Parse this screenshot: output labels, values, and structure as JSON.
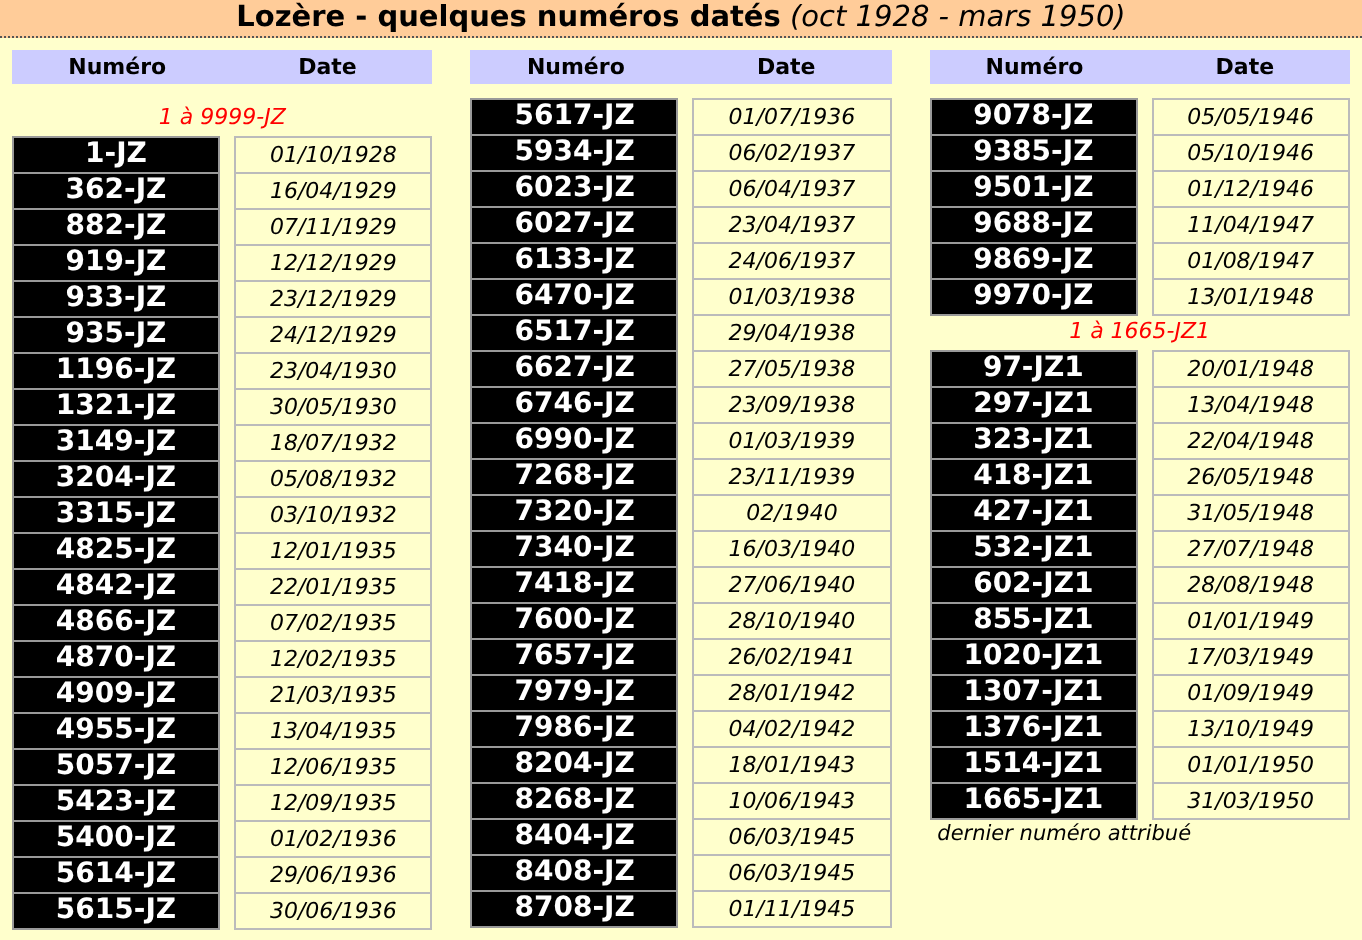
{
  "title": "**Lozère - quelques numéros datés** *(oct 1928 - mars 1950)*",
  "columns": [
    {
      "headers": [
        "Numéro",
        "Date"
      ],
      "groups": [
        {
          "label": "1 à 9999-JZ",
          "rows": [
            [
              "1-JZ",
              "01/10/1928"
            ],
            [
              "362-JZ",
              "16/04/1929"
            ],
            [
              "882-JZ",
              "07/11/1929"
            ],
            [
              "919-JZ",
              "12/12/1929"
            ],
            [
              "933-JZ",
              "23/12/1929"
            ],
            [
              "935-JZ",
              "24/12/1929"
            ],
            [
              "1196-JZ",
              "23/04/1930"
            ],
            [
              "1321-JZ",
              "30/05/1930"
            ],
            [
              "3149-JZ",
              "18/07/1932"
            ],
            [
              "3204-JZ",
              "05/08/1932"
            ],
            [
              "3315-JZ",
              "03/10/1932"
            ],
            [
              "4825-JZ",
              "12/01/1935"
            ],
            [
              "4842-JZ",
              "22/01/1935"
            ],
            [
              "4866-JZ",
              "07/02/1935"
            ],
            [
              "4870-JZ",
              "12/02/1935"
            ],
            [
              "4909-JZ",
              "21/03/1935"
            ],
            [
              "4955-JZ",
              "13/04/1935"
            ],
            [
              "5057-JZ",
              "12/06/1935"
            ],
            [
              "5423-JZ",
              "12/09/1935"
            ],
            [
              "5400-JZ",
              "01/02/1936"
            ],
            [
              "5614-JZ",
              "29/06/1936"
            ],
            [
              "5615-JZ",
              "30/06/1936"
            ]
          ]
        }
      ]
    },
    {
      "headers": [
        "Numéro",
        "Date"
      ],
      "groups": [
        {
          "rows": [
            [
              "5617-JZ",
              "01/07/1936"
            ],
            [
              "5934-JZ",
              "06/02/1937"
            ],
            [
              "6023-JZ",
              "06/04/1937"
            ],
            [
              "6027-JZ",
              "23/04/1937"
            ],
            [
              "6133-JZ",
              "24/06/1937"
            ],
            [
              "6470-JZ",
              "01/03/1938"
            ],
            [
              "6517-JZ",
              "29/04/1938"
            ],
            [
              "6627-JZ",
              "27/05/1938"
            ],
            [
              "6746-JZ",
              "23/09/1938"
            ],
            [
              "6990-JZ",
              "01/03/1939"
            ],
            [
              "7268-JZ",
              "23/11/1939"
            ],
            [
              "7320-JZ",
              "02/1940"
            ],
            [
              "7340-JZ",
              "16/03/1940"
            ],
            [
              "7418-JZ",
              "27/06/1940"
            ],
            [
              "7600-JZ",
              "28/10/1940"
            ],
            [
              "7657-JZ",
              "26/02/1941"
            ],
            [
              "7979-JZ",
              "28/01/1942"
            ],
            [
              "7986-JZ",
              "04/02/1942"
            ],
            [
              "8204-JZ",
              "18/01/1943"
            ],
            [
              "8268-JZ",
              "10/06/1943"
            ],
            [
              "8404-JZ",
              "06/03/1945"
            ],
            [
              "8408-JZ",
              "06/03/1945"
            ],
            [
              "8708-JZ",
              "01/11/1945"
            ]
          ]
        }
      ]
    },
    {
      "headers": [
        "Numéro",
        "Date"
      ],
      "groups": [
        {
          "rows": [
            [
              "9078-JZ",
              "05/05/1946"
            ],
            [
              "9385-JZ",
              "05/10/1946"
            ],
            [
              "9501-JZ",
              "01/12/1946"
            ],
            [
              "9688-JZ",
              "11/04/1947"
            ],
            [
              "9869-JZ",
              "01/08/1947"
            ],
            [
              "9970-JZ",
              "13/01/1948"
            ]
          ]
        },
        {
          "label": "1 à 1665-JZ1",
          "rows": [
            [
              "97-JZ1",
              "20/01/1948"
            ],
            [
              "297-JZ1",
              "13/04/1948"
            ],
            [
              "323-JZ1",
              "22/04/1948"
            ],
            [
              "418-JZ1",
              "26/05/1948"
            ],
            [
              "427-JZ1",
              "31/05/1948"
            ],
            [
              "532-JZ1",
              "27/07/1948"
            ],
            [
              "602-JZ1",
              "28/08/1948"
            ],
            [
              "855-JZ1",
              "01/01/1949"
            ],
            [
              "1020-JZ1",
              "17/03/1949"
            ],
            [
              "1307-JZ1",
              "01/09/1949"
            ],
            [
              "1376-JZ1",
              "13/10/1949"
            ],
            [
              "1514-JZ1",
              "01/01/1950"
            ],
            [
              "1665-JZ1",
              "31/03/1950"
            ]
          ]
        }
      ],
      "note": "dernier numéro attribué"
    }
  ]
}
